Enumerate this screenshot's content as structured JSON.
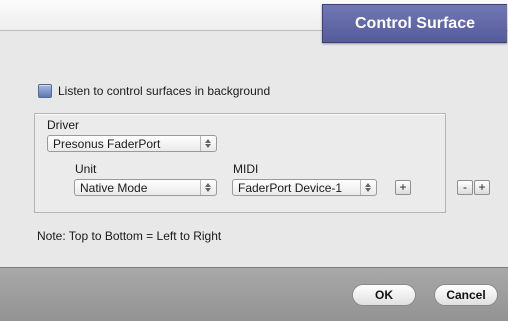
{
  "dialog": {
    "title": "Control Surface",
    "background_listen": {
      "label": "Listen to control surfaces in background",
      "checked": true
    },
    "driver": {
      "label": "Driver",
      "value": "Presonus FaderPort"
    },
    "unit": {
      "label": "Unit",
      "value": "Native Mode"
    },
    "midi": {
      "label": "MIDI",
      "value": "FaderPort Device-1",
      "add_label": "+"
    },
    "list_controls": {
      "remove_label": "-",
      "add_label": "+"
    },
    "note": "Note: Top to Bottom = Left to Right",
    "buttons": {
      "ok": "OK",
      "cancel": "Cancel"
    }
  },
  "colors": {
    "title_tab": "#5f64a6",
    "checkbox": "#6f88bf",
    "footer": "#9e9e9e"
  }
}
